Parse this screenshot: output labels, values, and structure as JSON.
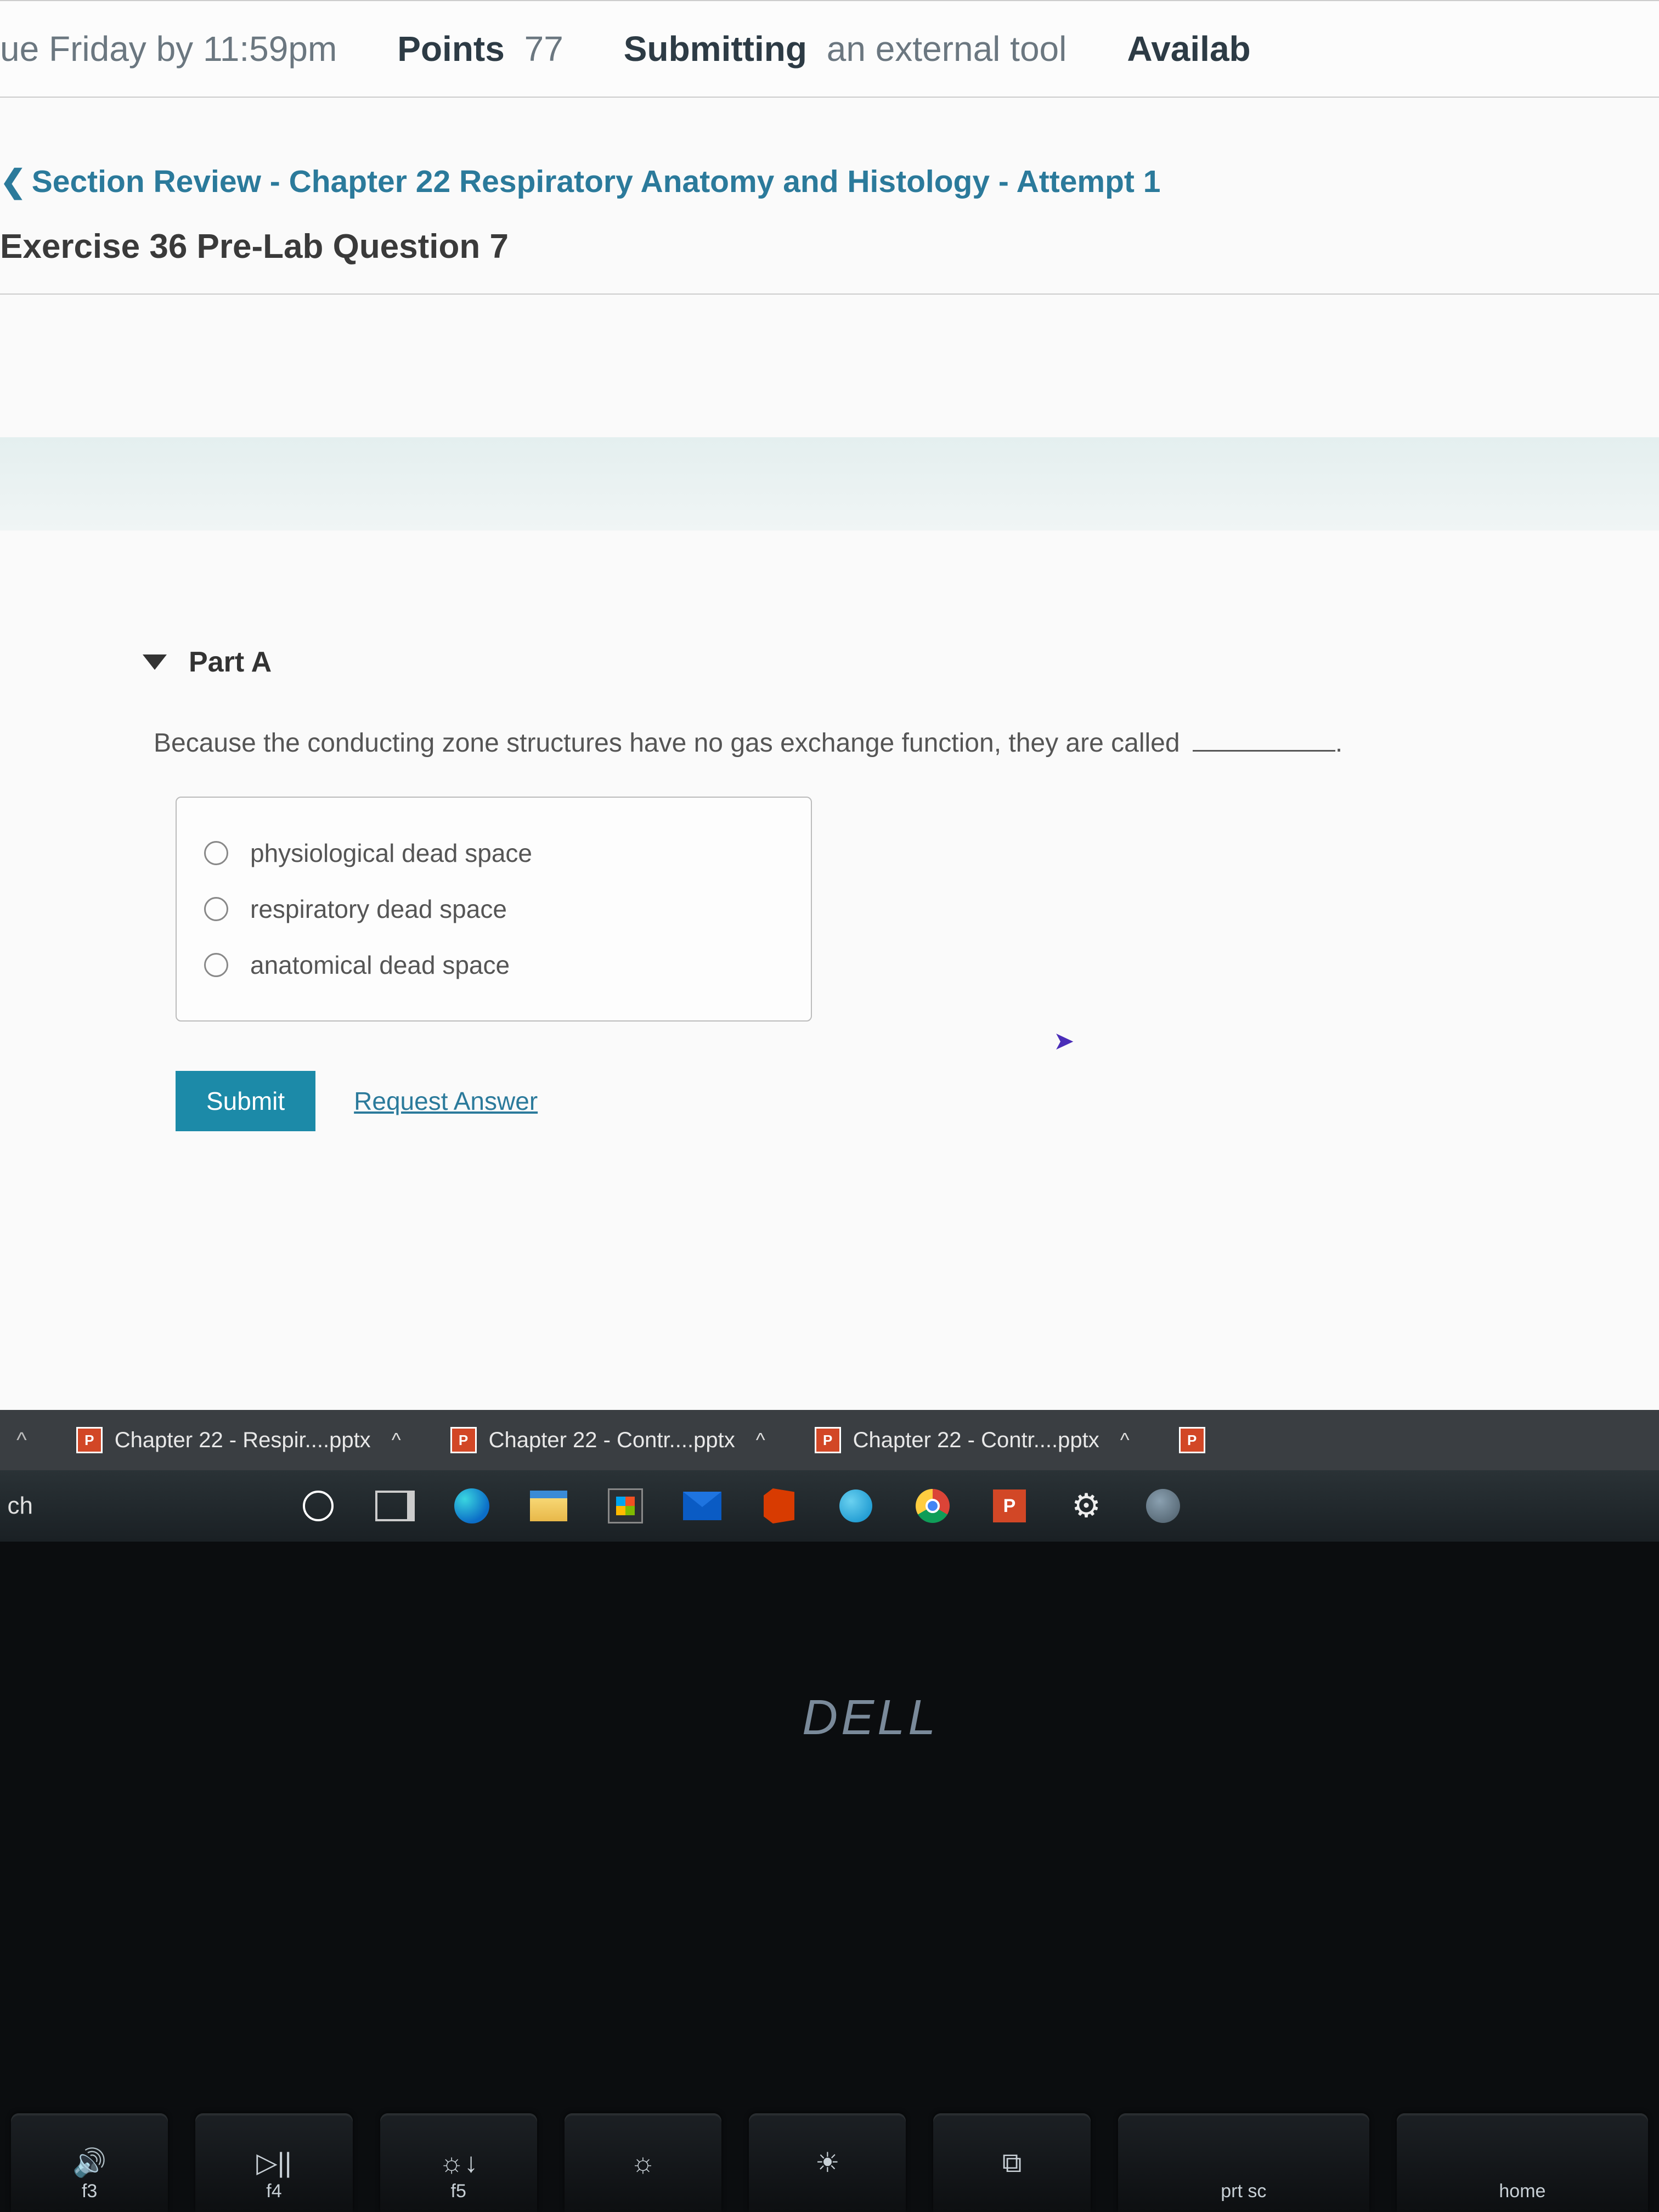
{
  "assignment": {
    "due_label": "ue",
    "due_value": "Friday by 11:59pm",
    "points_label": "Points",
    "points_value": "77",
    "submitting_label": "Submitting",
    "submitting_value": "an external tool",
    "availability_label": "Availab"
  },
  "section_nav": "Section Review - Chapter 22 Respiratory Anatomy and Histology - Attempt 1",
  "exercise_title": "Exercise 36 Pre-Lab Question 7",
  "part": {
    "label": "Part A",
    "question_text": "Because the conducting zone structures have no gas exchange function, they are called",
    "options": [
      "physiological dead space",
      "respiratory dead space",
      "anatomical dead space"
    ],
    "submit_label": "Submit",
    "request_label": "Request Answer"
  },
  "downloads": {
    "items": [
      "Chapter 22 - Respir....pptx",
      "Chapter 22 - Contr....pptx",
      "Chapter 22 - Contr....pptx"
    ]
  },
  "taskbar": {
    "search_fragment": "ch"
  },
  "laptop": {
    "brand": "DELL"
  },
  "keyboard": {
    "keys": [
      {
        "glyph": "🔊",
        "label": "F3"
      },
      {
        "glyph": "▷||",
        "label": "F4"
      },
      {
        "glyph": "☼↓",
        "label": "F5"
      },
      {
        "glyph": "☼",
        "label": ""
      },
      {
        "glyph": "☀",
        "label": ""
      },
      {
        "glyph": "⧉",
        "label": ""
      },
      {
        "glyph": "",
        "label": "prt sc"
      },
      {
        "glyph": "",
        "label": "home"
      }
    ]
  }
}
